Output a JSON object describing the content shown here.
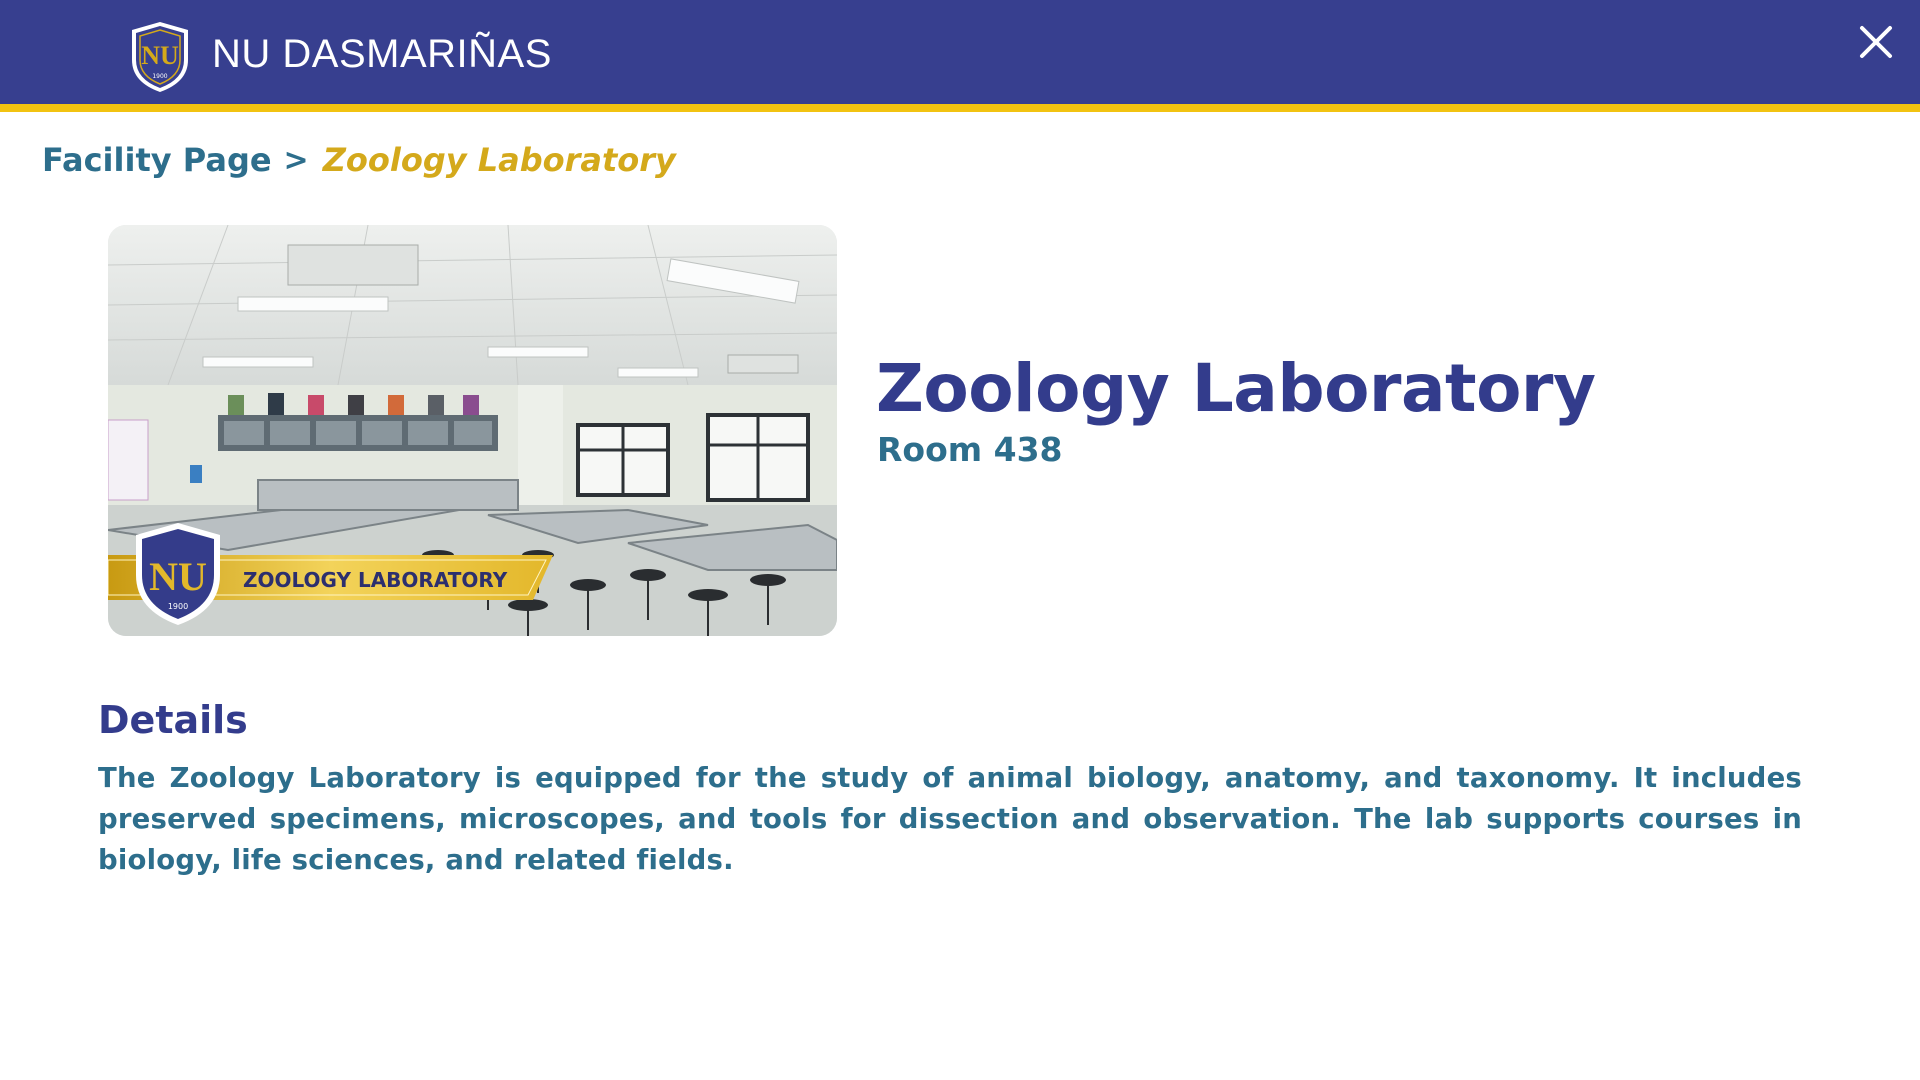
{
  "header": {
    "brand": "NU DASMARIÑAS",
    "logo_text": "NU",
    "logo_year": "1900",
    "close_icon": "close-icon",
    "colors": {
      "bar": "#373f8f",
      "accent": "#f2c311"
    }
  },
  "breadcrumb": {
    "root": "Facility Page",
    "separator": ">",
    "current": "Zoology Laboratory"
  },
  "facility": {
    "image_banner": "ZOOLOGY LABORATORY",
    "title": "Zoology Laboratory",
    "room": "Room 438"
  },
  "details": {
    "heading": "Details",
    "body": "The Zoology Laboratory is equipped for the study of animal biology, anatomy, and taxonomy. It includes preserved specimens, microscopes, and tools for dissection and observation. The lab supports courses in biology, life sciences, and related fields."
  },
  "colors": {
    "title": "#333c8c",
    "secondary": "#2d6e8c",
    "current_crumb": "#d4a91b"
  }
}
